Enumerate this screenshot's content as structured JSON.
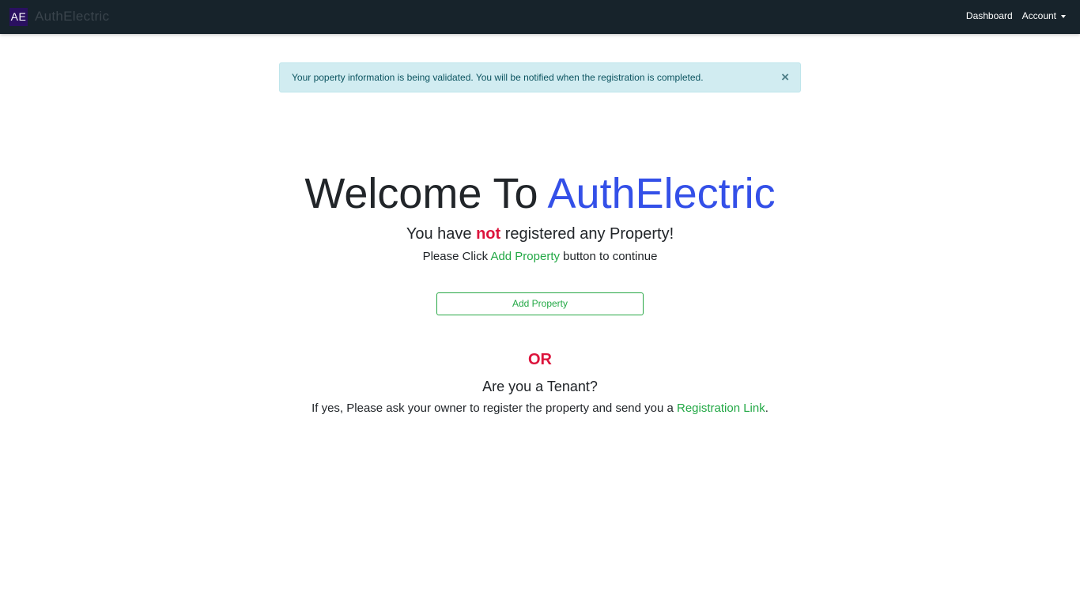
{
  "navbar": {
    "logo_text": "AE",
    "brand_name": "AuthElectric",
    "dashboard_label": "Dashboard",
    "account_label": "Account"
  },
  "alert": {
    "message": "Your poperty information is being validated. You will be notified when the registration is completed.",
    "close_symbol": "×"
  },
  "welcome": {
    "prefix": "Welcome To ",
    "brand": "AuthElectric"
  },
  "status": {
    "part1": "You have ",
    "emphasis": "not",
    "part2": " registered any Property!"
  },
  "instruction": {
    "part1": "Please Click ",
    "link": "Add Property",
    "part2": " button to continue"
  },
  "add_property_button": "Add Property",
  "or_label": "OR",
  "tenant": {
    "question": "Are you a Tenant?",
    "info_part1": "If yes, Please ask your owner to register the property and send you a ",
    "info_link": "Registration Link",
    "info_part2": "."
  },
  "colors": {
    "navbar_bg": "#17232b",
    "brand_accent": "#3450e8",
    "danger": "#dc143c",
    "success": "#22a845",
    "alert_bg": "#d1ecf1",
    "alert_text": "#0c5460"
  }
}
